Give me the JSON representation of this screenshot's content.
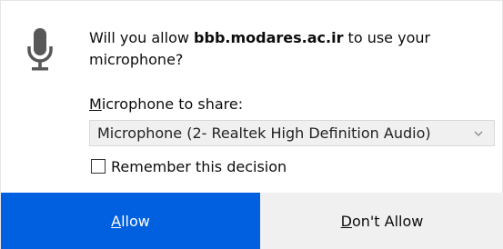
{
  "dialog": {
    "message_prefix": "Will you allow ",
    "host": "bbb.modares.ac.ir",
    "message_suffix": " to use your microphone?",
    "share_label_accesskey": "M",
    "share_label_rest": "icrophone to share:",
    "selected_device": "Microphone (2- Realtek High Definition Audio)",
    "remember_label": "Remember this decision",
    "remember_checked": false
  },
  "buttons": {
    "allow_accesskey": "A",
    "allow_rest": "llow",
    "deny_accesskey": "D",
    "deny_rest": "on't Allow"
  },
  "icons": {
    "mic": "microphone-icon",
    "dropdown": "chevron-down-icon"
  },
  "colors": {
    "primary_button": "#0060df",
    "secondary_button": "#f0f0f0",
    "icon": "#585858"
  }
}
